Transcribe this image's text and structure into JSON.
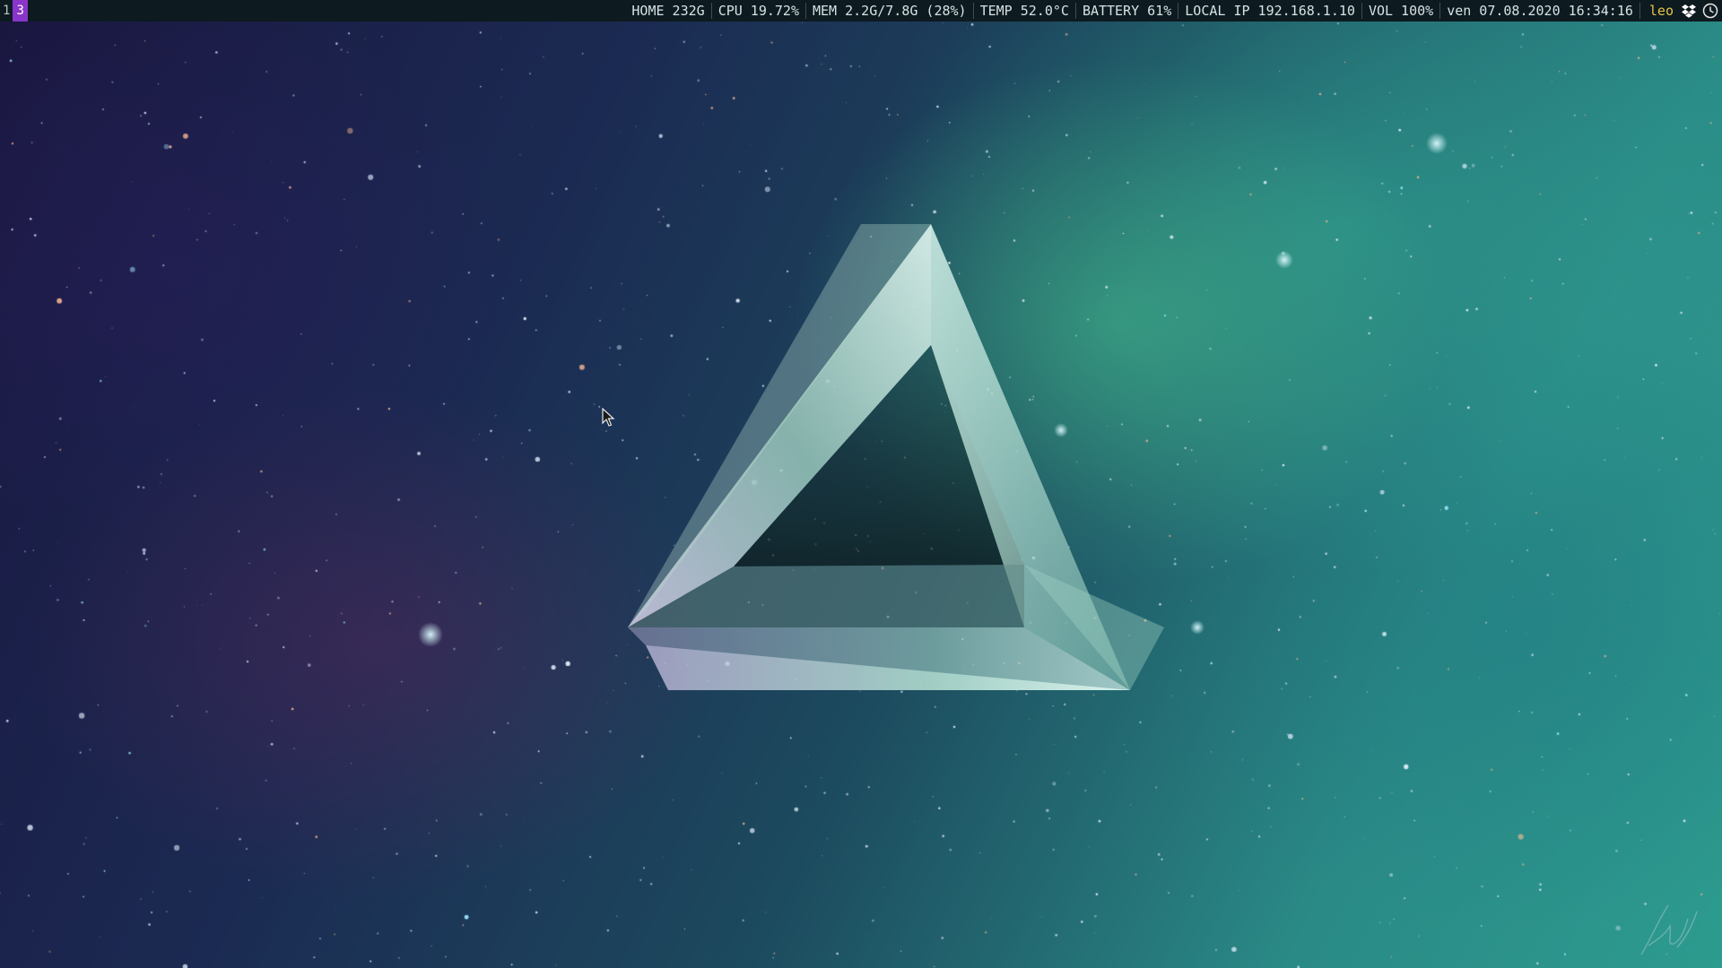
{
  "workspaces": [
    {
      "label": "1",
      "active": false
    },
    {
      "label": "3",
      "active": true
    }
  ],
  "status": {
    "home": "HOME 232G",
    "cpu": "CPU 19.72%",
    "mem": "MEM 2.2G/7.8G (28%)",
    "temp": "TEMP 52.0°C",
    "battery": "BATTERY 61%",
    "ip": "LOCAL IP 192.168.1.10",
    "vol": "VOL 100%",
    "datetime": "ven 07.08.2020 16:34:16",
    "user": "leo"
  },
  "tray_icons": [
    "dropbox-icon",
    "clock-icon"
  ],
  "colors": {
    "bar_bg": "#0d1a1f",
    "active_workspace": "#8a35c9",
    "user_text": "#e6c24a",
    "bar_text": "#d6e2e4"
  },
  "wallpaper": "space nebula with impossible triangle"
}
